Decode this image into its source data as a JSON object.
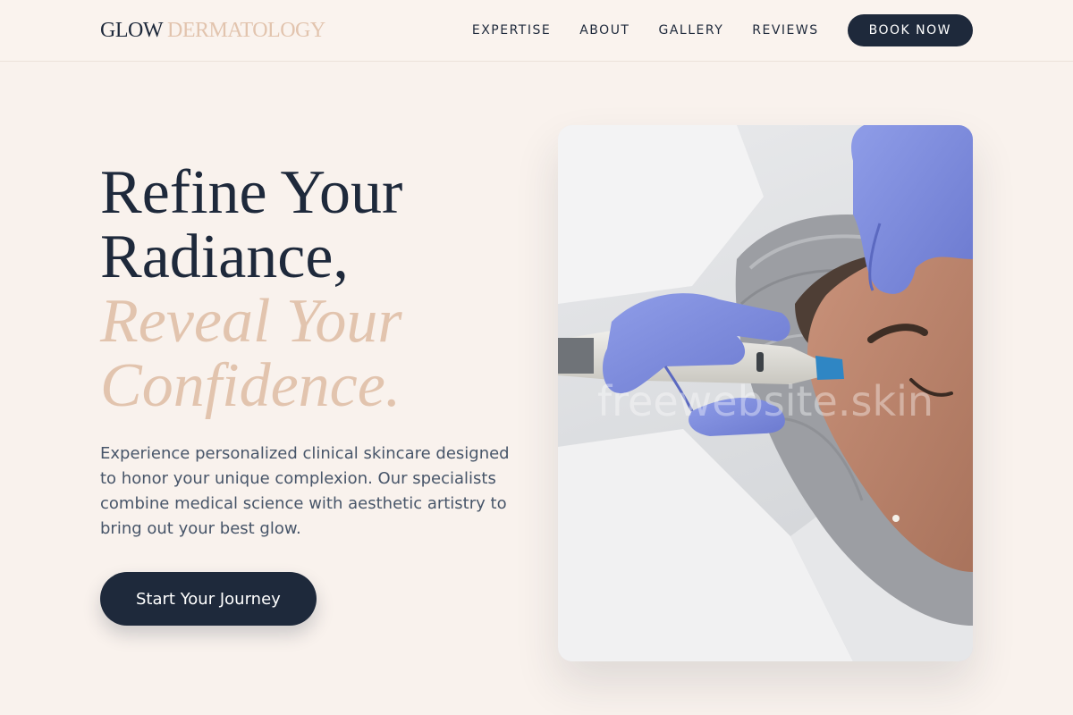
{
  "brand": {
    "part1": "GLOW",
    "part2": "DERMATOLOGY"
  },
  "nav": {
    "items": [
      "EXPERTISE",
      "ABOUT",
      "GALLERY",
      "REVIEWS"
    ],
    "cta": "BOOK NOW"
  },
  "hero": {
    "line1": "Refine Your",
    "line2": "Radiance,",
    "line3": "Reveal Your",
    "line4": "Confidence.",
    "description": "Experience personalized clinical skincare designed to honor your unique complexion. Our specialists combine medical science with aesthetic artistry to bring out your best glow.",
    "cta": "Start Your Journey"
  },
  "image": {
    "watermark": "freewebsite.skin"
  },
  "colors": {
    "background": "#f9f2ed",
    "navy": "#1e293b",
    "accent": "#e2c4ae",
    "body_text": "#475569"
  }
}
